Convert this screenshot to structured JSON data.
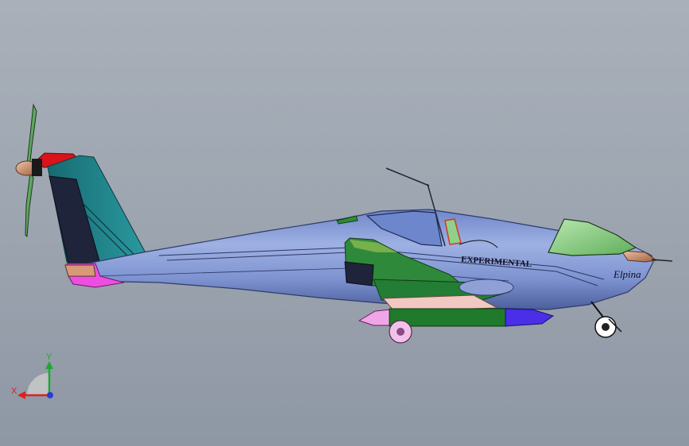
{
  "viewport": {
    "background_top": "#a9b0ba",
    "background_bottom": "#8e97a4"
  },
  "model": {
    "fuselage_text": "EXPERIMENTAL",
    "script_text": "Elpina",
    "colors": {
      "fuselage": "#8ea0d6",
      "fin": "#1f7f86",
      "rudder": "#20243a",
      "cowl_red": "#d8141a",
      "spinner": "#d79a78",
      "canopy": "#8fd08a",
      "pontoon_green": "#1f7a2c",
      "pontoon_pink": "#f0a6e6",
      "pontoon_blue": "#4a2ee8",
      "tail_pink": "#ee4ee0"
    }
  },
  "triad": {
    "x_label": "X",
    "y_label": "Y",
    "x_color": "#e0201c",
    "y_color": "#1fa833",
    "z_color": "#2a3bd6"
  }
}
